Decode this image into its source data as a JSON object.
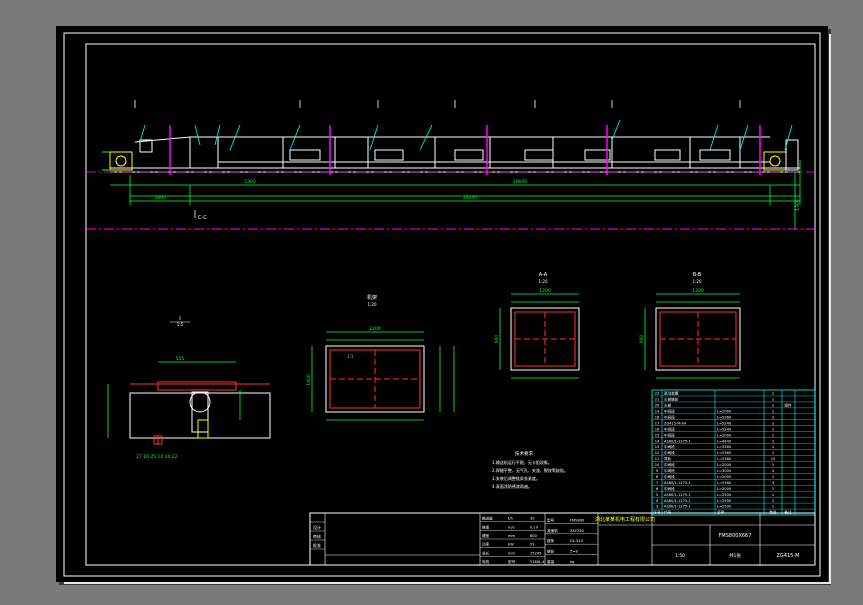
{
  "drawing": {
    "company": "湖北某某机电工程有限公司",
    "product": "FMS800X667",
    "drawing_no": "ZG415-M"
  },
  "views": {
    "section_a_label": "A-A",
    "section_b_label": "B-B",
    "section_c_label": "C-C",
    "detail_label": "I",
    "frame_label": "机架",
    "scale_a": "1:20",
    "scale_b": "1:20",
    "scale_c": "1:20",
    "scale_i": "1:5"
  },
  "main_dims": {
    "total_length": "25245",
    "head_span": "2800",
    "middle_span": "19640",
    "height": "1300",
    "segment_1": "5360",
    "segment_2": "5360"
  },
  "section_dims": {
    "width_a": "1200",
    "height_a": "900",
    "width_b": "1200",
    "height_b": "900",
    "width_c": "2200",
    "height_c": "1400",
    "slope_label": "1:1"
  },
  "notes": {
    "title": "技术要求",
    "lines": [
      "1.输送机运行平稳，无卡阻现象。",
      "2.焊缝平整，无气孔、夹渣、裂纹等缺陷。",
      "3.安装后调整链条张紧度。",
      "4.表面涂防锈漆两遍。"
    ]
  },
  "parts_list": {
    "rows": [
      [
        "22",
        "驱动装置",
        "",
        "1",
        ""
      ],
      [
        "21",
        "头部链轮",
        "",
        "1",
        ""
      ],
      [
        "20",
        "头部",
        "",
        "1",
        "组件"
      ],
      [
        "19",
        "中间段",
        "L=2000",
        "1",
        ""
      ],
      [
        "18",
        "中间段",
        "L=5360",
        "2",
        ""
      ],
      [
        "17",
        "ZG415-M-04",
        "L=5240",
        "1",
        ""
      ],
      [
        "16",
        "中间段",
        "L=5240",
        "1",
        ""
      ],
      [
        "15",
        "中间段",
        "L=2000",
        "1",
        ""
      ],
      [
        "14",
        "AS60/1-1275-1",
        "L=4440",
        "1",
        ""
      ],
      [
        "13",
        "中间段",
        "L=5360",
        "1",
        ""
      ],
      [
        "12",
        "中间段",
        "L=5360",
        "1",
        ""
      ],
      [
        "11",
        "导轨",
        "L=5360",
        "10",
        ""
      ],
      [
        "10",
        "中间段",
        "L=2000",
        "1",
        ""
      ],
      [
        "9",
        "中间段",
        "L=3000",
        "4",
        ""
      ],
      [
        "8",
        "中间段",
        "L=2000",
        "1",
        ""
      ],
      [
        "7",
        "AS60/1-1275-1",
        "L=5360",
        "3",
        ""
      ],
      [
        "6",
        "中间段",
        "L=2000",
        "1",
        ""
      ],
      [
        "5",
        "AS60/1-1275-1",
        "L=2500",
        "1",
        ""
      ],
      [
        "4",
        "AS60/1-1275-1",
        "L=2500",
        "1",
        ""
      ],
      [
        "3",
        "AS60/1-1275-1",
        "L=2500",
        "1",
        ""
      ]
    ],
    "header": [
      "序号",
      "代号",
      "名称",
      "数量",
      "备注"
    ]
  },
  "title_block": {
    "specs_left": [
      [
        "输送量",
        "t/h",
        "30"
      ],
      [
        "链速",
        "m/s",
        "0.19"
      ],
      [
        "槽宽",
        "mm",
        "800"
      ],
      [
        "功率",
        "kW",
        "22"
      ],
      [
        "总长",
        "mm",
        "25245"
      ],
      [
        "电机",
        "型号",
        "Y180L-4"
      ]
    ],
    "specs_mid": [
      [
        "型号",
        "FMS800"
      ],
      [
        "减速机",
        "ZSY250"
      ],
      [
        "链条",
        "DL-315"
      ],
      [
        "链轮",
        "Z=8"
      ],
      [
        "重量",
        "kg"
      ]
    ],
    "designer": "设计",
    "checker": "审核",
    "approver": "批准",
    "scale": "1:50",
    "sheet": "共1张"
  }
}
